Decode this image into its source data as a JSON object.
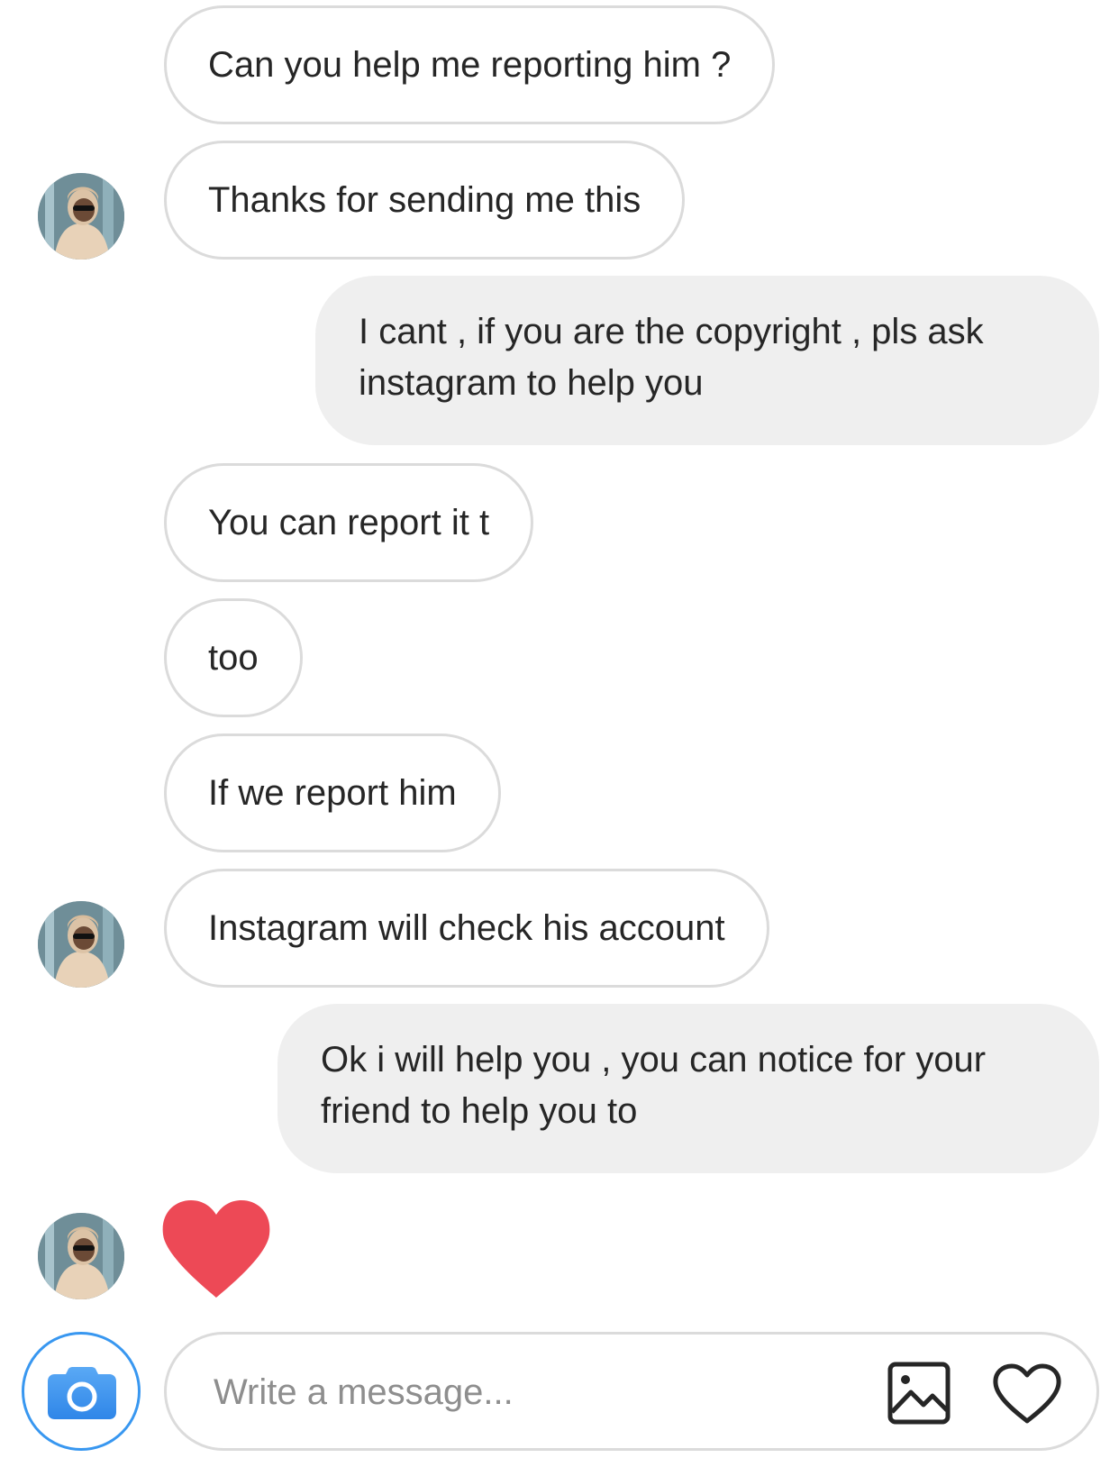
{
  "conversation": {
    "messages": [
      {
        "direction": "received",
        "text": "Can you help me reporting him ?",
        "avatar": false
      },
      {
        "direction": "received",
        "text": "Thanks for sending me this",
        "avatar": true
      },
      {
        "direction": "sent",
        "text": "I cant , if you are the copyright , pls ask instagram to help you"
      },
      {
        "direction": "received",
        "text": "You can report it t",
        "avatar": false
      },
      {
        "direction": "received",
        "text": "too",
        "avatar": false
      },
      {
        "direction": "received",
        "text": "If we report him",
        "avatar": false
      },
      {
        "direction": "received",
        "text": "Instagram will check his account",
        "avatar": true
      },
      {
        "direction": "sent",
        "text": "Ok i will help you , you can notice for your friend to help you to"
      },
      {
        "direction": "received",
        "type": "heart-reaction",
        "icon": "heart-icon",
        "color": "#ed4956",
        "avatar": true
      }
    ]
  },
  "composer": {
    "placeholder": "Write a message...",
    "value": "",
    "camera_icon": "camera-icon",
    "gallery_icon": "gallery-icon",
    "like_icon": "heart-outline-icon",
    "accent_color": "#3897f0"
  }
}
